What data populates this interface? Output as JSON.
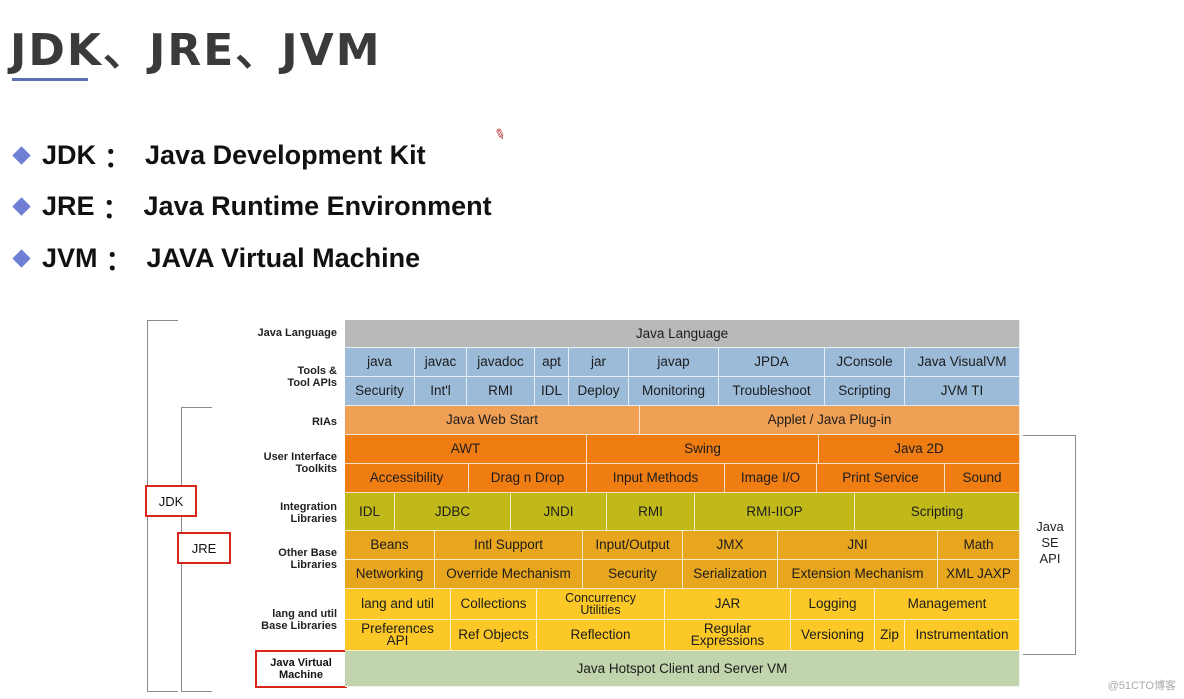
{
  "title": "JDK、JRE、JVM",
  "bullets": [
    {
      "term": "JDK",
      "sep": "：",
      "desc": "Java Development Kit"
    },
    {
      "term": "JRE",
      "sep": "：",
      "desc": "Java Runtime Environment"
    },
    {
      "term": "JVM",
      "sep": "：",
      "desc": "JAVA Virtual Machine"
    }
  ],
  "diagram": {
    "row_labels": {
      "java_language": "Java Language",
      "tools_1": "Tools &",
      "tools_2": "Tool APIs",
      "rias": "RIAs",
      "ui_1": "User Interface",
      "ui_2": "Toolkits",
      "integ_1": "Integration",
      "integ_2": "Libraries",
      "other_1": "Other Base",
      "other_2": "Libraries",
      "lang_1": "lang and util",
      "lang_2": "Base Libraries",
      "jvm_1": "Java Virtual",
      "jvm_2": "Machine"
    },
    "java_language": "Java Language",
    "tools_row1": [
      "java",
      "javac",
      "javadoc",
      "apt",
      "jar",
      "javap",
      "JPDA",
      "JConsole",
      "Java VisualVM"
    ],
    "tools_row2": [
      "Security",
      "Int'l",
      "RMI",
      "IDL",
      "Deploy",
      "Monitoring",
      "Troubleshoot",
      "Scripting",
      "JVM TI"
    ],
    "rias": [
      "Java Web Start",
      "Applet / Java Plug-in"
    ],
    "ui_row1": [
      "AWT",
      "Swing",
      "Java 2D"
    ],
    "ui_row2": [
      "Accessibility",
      "Drag n Drop",
      "Input Methods",
      "Image I/O",
      "Print Service",
      "Sound"
    ],
    "integration": [
      "IDL",
      "JDBC",
      "JNDI",
      "RMI",
      "RMI-IIOP",
      "Scripting"
    ],
    "other_row1": [
      "Beans",
      "Intl Support",
      "Input/Output",
      "JMX",
      "JNI",
      "Math"
    ],
    "other_row2": [
      "Networking",
      "Override Mechanism",
      "Security",
      "Serialization",
      "Extension Mechanism",
      "XML JAXP"
    ],
    "lang_row1": [
      "lang and util",
      "Collections",
      "Concurrency Utilities",
      "JAR",
      "Logging",
      "Management"
    ],
    "lang_row2": [
      "Preferences API",
      "Ref Objects",
      "Reflection",
      "Regular Expressions",
      "Versioning",
      "Zip",
      "Instrumentation"
    ],
    "jvm": "Java Hotspot Client and Server VM",
    "labels": {
      "jdk": "JDK",
      "jre": "JRE",
      "api_1": "Java",
      "api_2": "SE",
      "api_3": "API"
    }
  },
  "watermark": "@51CTO博客"
}
